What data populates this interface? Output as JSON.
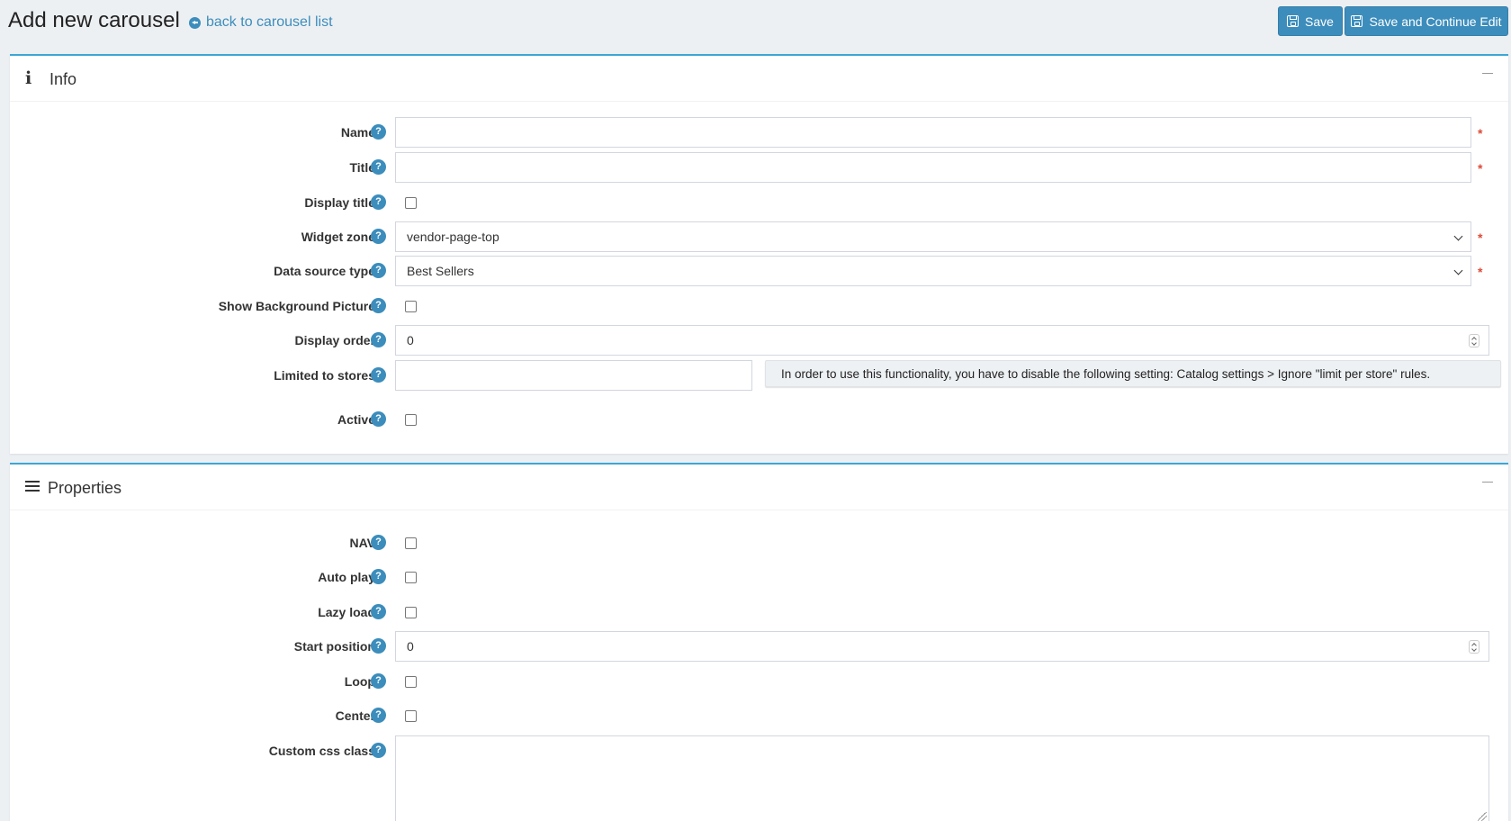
{
  "header": {
    "title": "Add new carousel",
    "back_link": "back to carousel list",
    "save_label": "Save",
    "save_continue_label": "Save and Continue Edit"
  },
  "info_card": {
    "title": "Info",
    "fields": {
      "name": {
        "label": "Name",
        "value": ""
      },
      "title": {
        "label": "Title",
        "value": ""
      },
      "display_title": {
        "label": "Display title",
        "checked": false
      },
      "widget_zone": {
        "label": "Widget zone",
        "value": "vendor-page-top"
      },
      "data_source_type": {
        "label": "Data source type",
        "value": "Best Sellers"
      },
      "show_background_picture": {
        "label": "Show Background Picture",
        "checked": false
      },
      "display_order": {
        "label": "Display order",
        "value": "0"
      },
      "limited_to_stores": {
        "label": "Limited to stores",
        "value": "",
        "note": "In order to use this functionality, you have to disable the following setting: Catalog settings > Ignore \"limit per store\" rules."
      },
      "active": {
        "label": "Active",
        "checked": false
      }
    }
  },
  "properties_card": {
    "title": "Properties",
    "fields": {
      "nav": {
        "label": "NAV",
        "checked": false
      },
      "auto_play": {
        "label": "Auto play",
        "checked": false
      },
      "lazy_load": {
        "label": "Lazy load",
        "checked": false
      },
      "start_position": {
        "label": "Start position",
        "value": "0"
      },
      "loop": {
        "label": "Loop",
        "checked": false
      },
      "center": {
        "label": "Center",
        "checked": false
      },
      "custom_css_class": {
        "label": "Custom css class",
        "value": ""
      }
    }
  },
  "help_glyph": "?",
  "required_glyph": "*",
  "colors": {
    "accent": "#3c8dbc",
    "card_border": "#3ca6d6",
    "required": "#dd4b39",
    "background": "#edf0f3"
  }
}
